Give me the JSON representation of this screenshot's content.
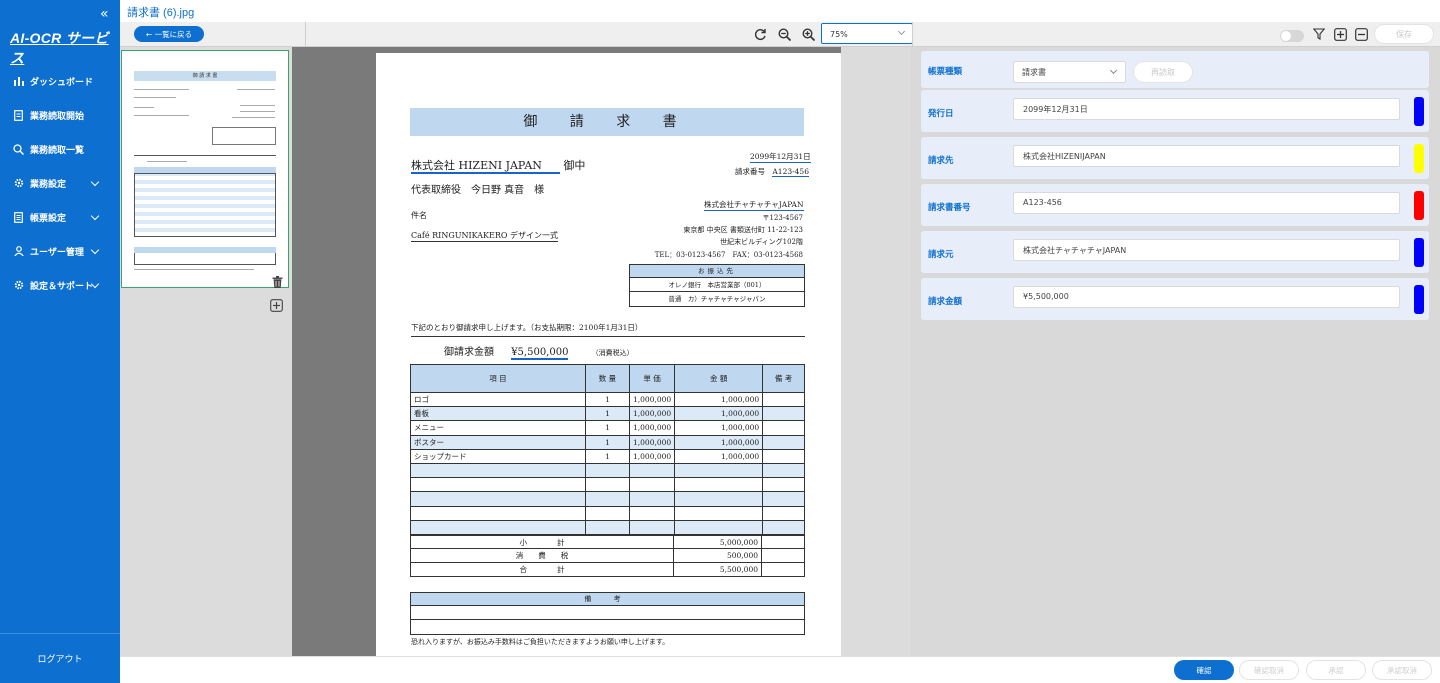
{
  "sidebar": {
    "brand": "AI-OCR サービス",
    "items": [
      {
        "label": "ダッシュボード",
        "icon": "bar-chart-icon",
        "expandable": false
      },
      {
        "label": "業務読取開始",
        "icon": "document-icon",
        "expandable": false
      },
      {
        "label": "業務読取一覧",
        "icon": "search-icon",
        "expandable": false
      },
      {
        "label": "業務設定",
        "icon": "gear-icon",
        "expandable": true
      },
      {
        "label": "帳票設定",
        "icon": "form-icon",
        "expandable": true
      },
      {
        "label": "ユーザー管理",
        "icon": "user-icon",
        "expandable": true
      },
      {
        "label": "設定＆サポート",
        "icon": "gear-icon",
        "expandable": true
      }
    ],
    "logout": "ログアウト"
  },
  "header": {
    "filename": "請求書 (6).jpg"
  },
  "toolbar": {
    "back_label": "← 一覧に戻る",
    "zoom_value": "75%",
    "save_label": "保存"
  },
  "document": {
    "title": "御 請 求 書",
    "recipient_company": "株式会社 HIZENI JAPAN",
    "recipient_suffix": "御中",
    "recipient_person": "代表取締役　今日野 真音　様",
    "date": "2099年12月31日",
    "invoice_no_label": "請求番号",
    "invoice_no": "A123-456",
    "subject_label": "件名",
    "subject": "Café RINGUNIKAKERO デザイン一式",
    "issuer": "株式会社チャチャチャJAPAN",
    "postal": "〒123-4567",
    "address1": "東京都 中央区 書類送付町 11-22-123",
    "address2": "世紀末ビルディング102階",
    "tel_fax": "TEL：03-0123-4567　FAX：03-0123-4568",
    "bank_header": "お振込先",
    "bank_line1": "オレノ銀行　本店営業部（001）",
    "bank_line2": "普通　カ）チャチャチャジャパン",
    "intro": "下記のとおり御請求申し上げます。（お支払期限：2100年1月31日）",
    "amount_label": "御請求金額",
    "amount": "¥5,500,000",
    "tax_note": "（消費税込）",
    "table_headers": [
      "項 目",
      "数 量",
      "単 価",
      "金 額",
      "備 考"
    ],
    "items": [
      {
        "name": "ロゴ",
        "qty": "1",
        "unit": "1,000,000",
        "amount": "1,000,000"
      },
      {
        "name": "看板",
        "qty": "1",
        "unit": "1,000,000",
        "amount": "1,000,000"
      },
      {
        "name": "メニュー",
        "qty": "1",
        "unit": "1,000,000",
        "amount": "1,000,000"
      },
      {
        "name": "ポスター",
        "qty": "1",
        "unit": "1,000,000",
        "amount": "1,000,000"
      },
      {
        "name": "ショップカード",
        "qty": "1",
        "unit": "1,000,000",
        "amount": "1,000,000"
      }
    ],
    "subtotal_label": "小　　　　計",
    "subtotal": "5,000,000",
    "tax_label": "消　　費　　税",
    "tax": "500,000",
    "total_label": "合　　　　計",
    "total": "5,500,000",
    "remarks_label": "備 考",
    "footer_note": "恐れ入りますが、お振込み手数料はご負担いただきますようお願い申し上げます。"
  },
  "fields": {
    "form_type_label": "帳票種類",
    "form_type_value": "請求書",
    "reread_label": "再読取",
    "rows": [
      {
        "label": "発行日",
        "value": "2099年12月31日",
        "color": "#0000ff"
      },
      {
        "label": "請求先",
        "value": "株式会社HIZENIJAPAN",
        "color": "#ffff00"
      },
      {
        "label": "請求書番号",
        "value": "A123-456",
        "color": "#ff0000"
      },
      {
        "label": "請求元",
        "value": "株式会社チャチャチャJAPAN",
        "color": "#0000ff"
      },
      {
        "label": "請求金額",
        "value": "¥5,500,000",
        "color": "#0000ff"
      }
    ]
  },
  "footer": {
    "confirm": "確認",
    "cancel_confirm": "確認取消",
    "approve": "承認",
    "cancel_approve": "承認取消"
  },
  "colors": {
    "primary": "#0d6fcf",
    "table_header": "#bfd8ef"
  }
}
